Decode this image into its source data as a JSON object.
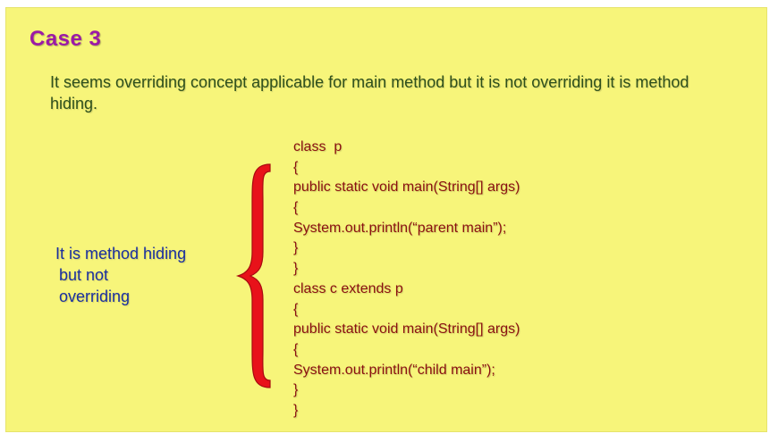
{
  "slide": {
    "title": "Case 3",
    "intro": "It seems overriding concept applicable for main method but it is not overriding it is method hiding.",
    "side_note": {
      "line1": "It is method hiding",
      "line2": "but not",
      "line3": "overriding"
    },
    "code_lines": [
      "class  p",
      "{",
      "public static void main(String[] args)",
      "{",
      "System.out.println(“parent main”);",
      "}",
      "}",
      "class c extends p",
      "{",
      "public static void main(String[] args)",
      "{",
      "System.out.println(“child main”);",
      "}",
      "}"
    ]
  },
  "colors": {
    "background": "#f7f57a",
    "title": "#9b1aa6",
    "intro": "#2e4f1c",
    "side_note": "#1a2fa0",
    "code": "#8a1010",
    "brace": "#e8121a"
  }
}
